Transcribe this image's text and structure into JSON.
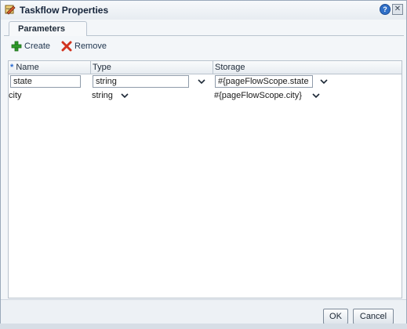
{
  "dialog": {
    "title": "Taskflow Properties",
    "help_label": "?",
    "close_label": "✕"
  },
  "tabs": [
    {
      "label": "Parameters",
      "selected": true
    }
  ],
  "toolbar": {
    "create_label": "Create",
    "remove_label": "Remove"
  },
  "table": {
    "columns": [
      {
        "label": "Name",
        "required_marker": "*"
      },
      {
        "label": "Type"
      },
      {
        "label": "Storage"
      }
    ],
    "rows": [
      {
        "name": "state",
        "type": "string",
        "storage": "#{pageFlowScope.state",
        "editing": true
      },
      {
        "name": "city",
        "type": "string",
        "storage": "#{pageFlowScope.city}",
        "editing": false
      }
    ]
  },
  "footer": {
    "ok_label": "OK",
    "cancel_label": "Cancel"
  },
  "colors": {
    "accent": "#2a6bd0",
    "header_text": "#15243a"
  }
}
